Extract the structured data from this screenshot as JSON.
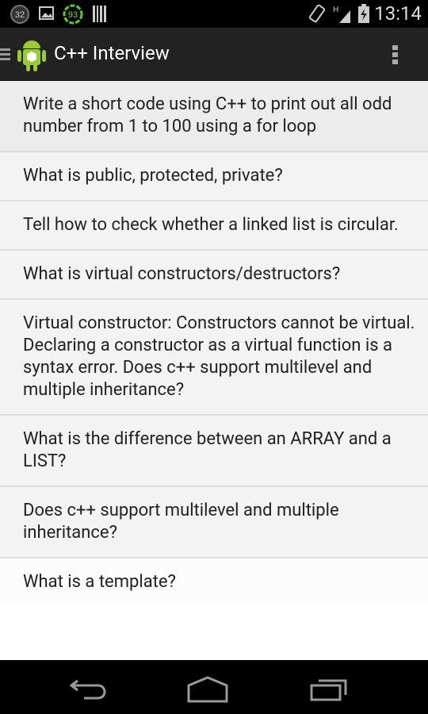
{
  "status_bar": {
    "notif_count": "32",
    "battery_percent_badge": "93",
    "time": "13:14",
    "icons": [
      "notification-count-icon",
      "image-icon",
      "battery-percent-icon",
      "barcode-icon",
      "rotation-icon",
      "signal-h-icon",
      "battery-charging-icon"
    ]
  },
  "action_bar": {
    "title": "C++ Interview",
    "icons": [
      "drawer-icon",
      "android-app-icon",
      "overflow-menu-icon"
    ]
  },
  "questions": [
    "Write a short code using C++ to print out all odd number from 1 to 100 using a for loop",
    "What is public, protected, private?",
    "Tell how to check whether a linked list is circular.",
    "What is virtual constructors/destructors?",
    "Virtual constructor: Constructors cannot be virtual. Declaring a constructor as a virtual function is a syntax error. Does c++ support multilevel and multiple inheritance?",
    "What is the difference between an ARRAY and a LIST?",
    "Does c++ support multilevel and multiple inheritance?",
    "What is a template?"
  ],
  "nav_bar": {
    "icons": [
      "back-icon",
      "home-icon",
      "recent-apps-icon"
    ]
  }
}
